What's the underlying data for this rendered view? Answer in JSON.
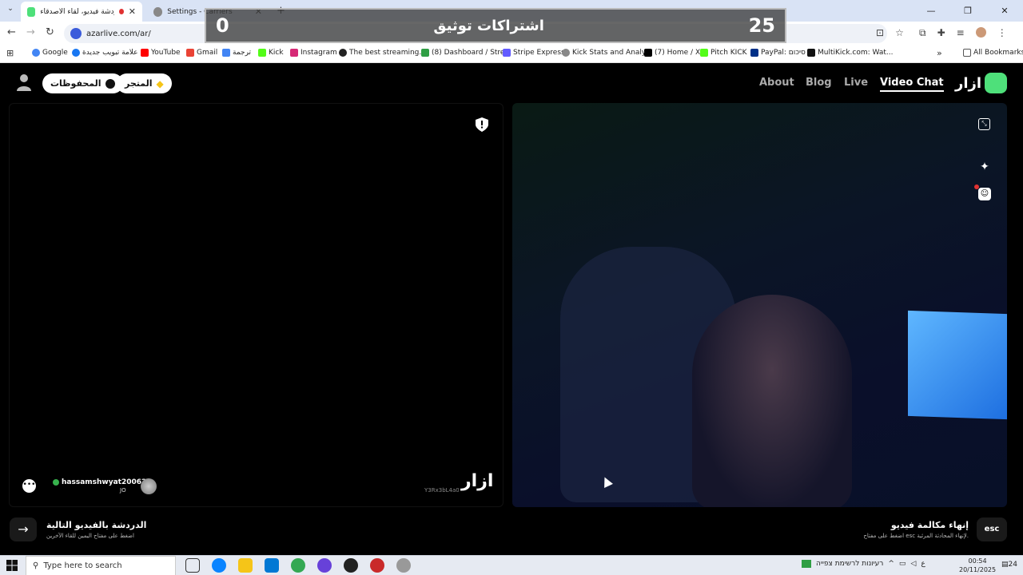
{
  "browser": {
    "tabs": [
      {
        "title": "أزار:دردشة فيديو، لقاء الأصدقاء",
        "active": true
      },
      {
        "title": "Settings - Carriers",
        "active": false
      }
    ],
    "url": "azarlive.com/ar/",
    "bookmarks": [
      "Google",
      "علامة تبويب جديدة",
      "YouTube",
      "Gmail",
      "ترجمة",
      "Kick",
      "Instagram",
      "The best streaming...",
      "(8) Dashboard / Stre...",
      "Stripe Express",
      "Kick Stats and Analy...",
      "(7) Home / X",
      "Pitch KICK",
      "PayPal: סיכום",
      "MultiKick.com: Wat..."
    ],
    "all_bookmarks": "All Bookmarks"
  },
  "overlay": {
    "left_count": "0",
    "title": "اشتراكات توثيق",
    "right_count": "25"
  },
  "header": {
    "saved_label": "المحفوظات",
    "store_label": "المتجر",
    "nav": [
      "About",
      "Blog",
      "Live",
      "Video Chat"
    ],
    "active_nav": "Video Chat",
    "logo_text": "ازار"
  },
  "video": {
    "username": "hassamshwyat200626",
    "country": "JO",
    "watermark_logo": "ازار",
    "watermark_id": "Y3Rx3bL4a0"
  },
  "actions": {
    "next_title": "الدردشة بالفيديو التالية",
    "next_sub": "اضغط على مفتاح اليمين للقاء الآخرين",
    "end_title": "إنهاء مكالمة فيديو",
    "end_sub": "اضغط على مفتاح esc لإنهاء المحادثة المرئية.",
    "esc_label": "esc"
  },
  "taskbar": {
    "search_placeholder": "Type here to search",
    "tray_text": "רעיונות לרשימת צפייה",
    "lang": "ع",
    "time": "00:54",
    "date": "20/11/2025",
    "notification_count": "24"
  },
  "colors": {
    "accent_green": "#4ee07a",
    "brand_red": "#e03131"
  }
}
